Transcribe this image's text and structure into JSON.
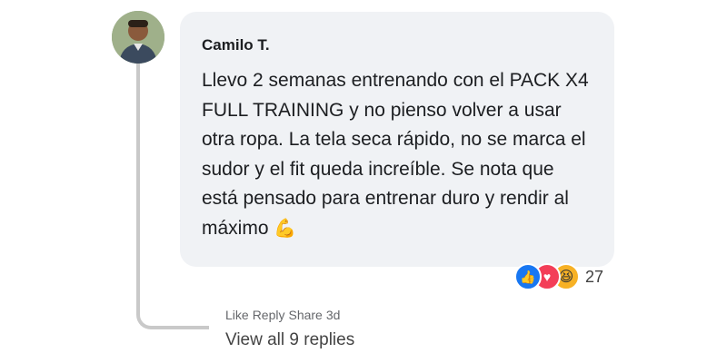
{
  "comment": {
    "author": "Camilo T.",
    "text_lines": [
      "Llevo 2 semanas entrenando con el PACK X4",
      "FULL TRAINING y no pienso volver a usar",
      "otra ropa. La tela seca rápido, no se marca el",
      "sudor y el fit queda increíble. Se nota que",
      "está pensado para entrenar duro y rendir al",
      "máximo"
    ],
    "trailing_emoji": "💪",
    "reactions": {
      "icons": [
        "like-icon",
        "love-icon",
        "haha-icon"
      ],
      "like_glyph": "👍",
      "love_glyph": "♥",
      "haha_glyph": "😆",
      "count": "27"
    },
    "actions": {
      "like": "Like",
      "reply": "Reply",
      "share": "Share",
      "time": "3d"
    },
    "view_replies": "View all 9 replies"
  },
  "colors": {
    "bubble_bg": "#f0f2f5",
    "like_blue": "#1877f2",
    "love_red": "#f33e58",
    "haha_yellow": "#f7b125",
    "thread_line": "#c9c9c9"
  }
}
